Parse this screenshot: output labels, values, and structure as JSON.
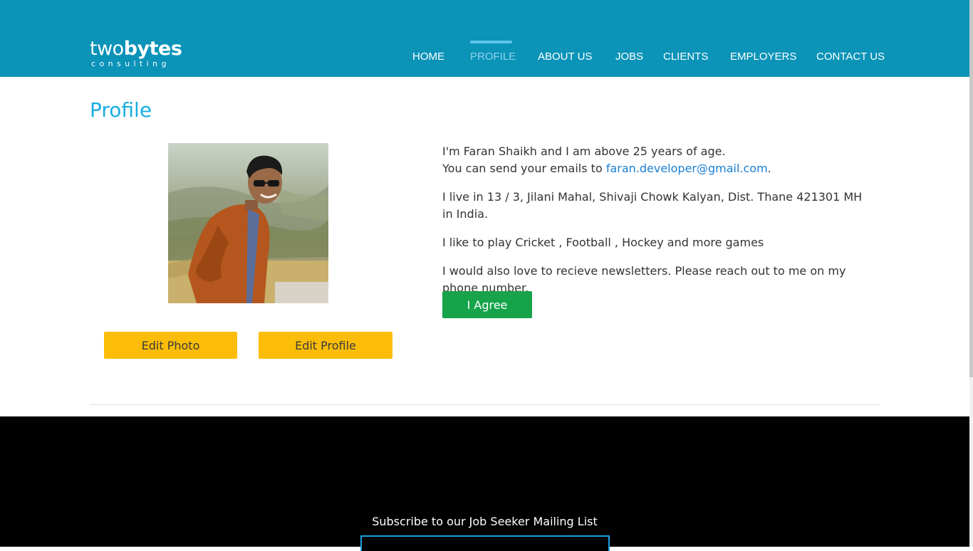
{
  "header": {
    "logo_main_light": "two",
    "logo_main_bold": "bytes",
    "logo_sub": "consulting",
    "nav": [
      {
        "label": "HOME"
      },
      {
        "label": "PROFILE"
      },
      {
        "label": "ABOUT US"
      },
      {
        "label": "JOBS"
      },
      {
        "label": "CLIENTS"
      },
      {
        "label": "EMPLOYERS"
      },
      {
        "label": "CONTACT US"
      }
    ],
    "active_nav": "PROFILE",
    "bg_color": "#0b93b8"
  },
  "page": {
    "title": "Profile"
  },
  "profile": {
    "photo_icon": "profile-photo",
    "edit_photo_label": "Edit Photo",
    "edit_profile_label": "Edit Profile",
    "intro_line1": "I'm Faran Shaikh and I am above 25 years of age.",
    "intro_line2_prefix": "You can send your emails to ",
    "email": "faran.developer@gmail.com",
    "intro_line2_suffix": ".",
    "address": "I live in 13 / 3, Jilani Mahal, Shivaji Chowk Kalyan, Dist. Thane 421301 MH in India.",
    "hobbies": "I like to play Cricket , Football , Hockey and more games",
    "newsletter": "I would also love to recieve newsletters. Please reach out to me on my phone number.",
    "agree_label": "I Agree"
  },
  "footer": {
    "subscribe_title": "Subscribe to our Job Seeker Mailing List"
  },
  "colors": {
    "accent": "#18aee0",
    "button_yellow": "#fbbd08",
    "button_green": "#16a34a",
    "link": "#1a7fd4"
  }
}
